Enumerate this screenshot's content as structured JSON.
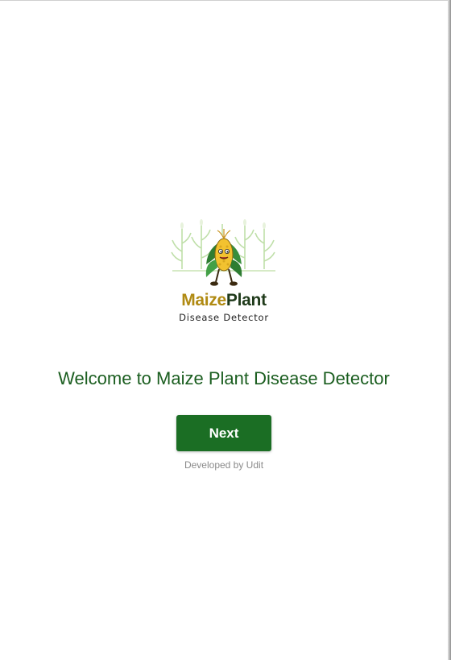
{
  "logo": {
    "icon": "maize-plant-logo",
    "name_part1": "Maize",
    "name_part2": "Plant",
    "subtitle": "Disease Detector",
    "colors": {
      "maize": "#b08a12",
      "plant": "#1f3a1a"
    }
  },
  "welcome": {
    "text": "Welcome to Maize Plant Disease Detector"
  },
  "actions": {
    "next_label": "Next"
  },
  "footer": {
    "credit": "Developed by Udit"
  },
  "colors": {
    "primary": "#1b6e24",
    "heading": "#1b5e20",
    "muted": "#8a8a8a"
  }
}
